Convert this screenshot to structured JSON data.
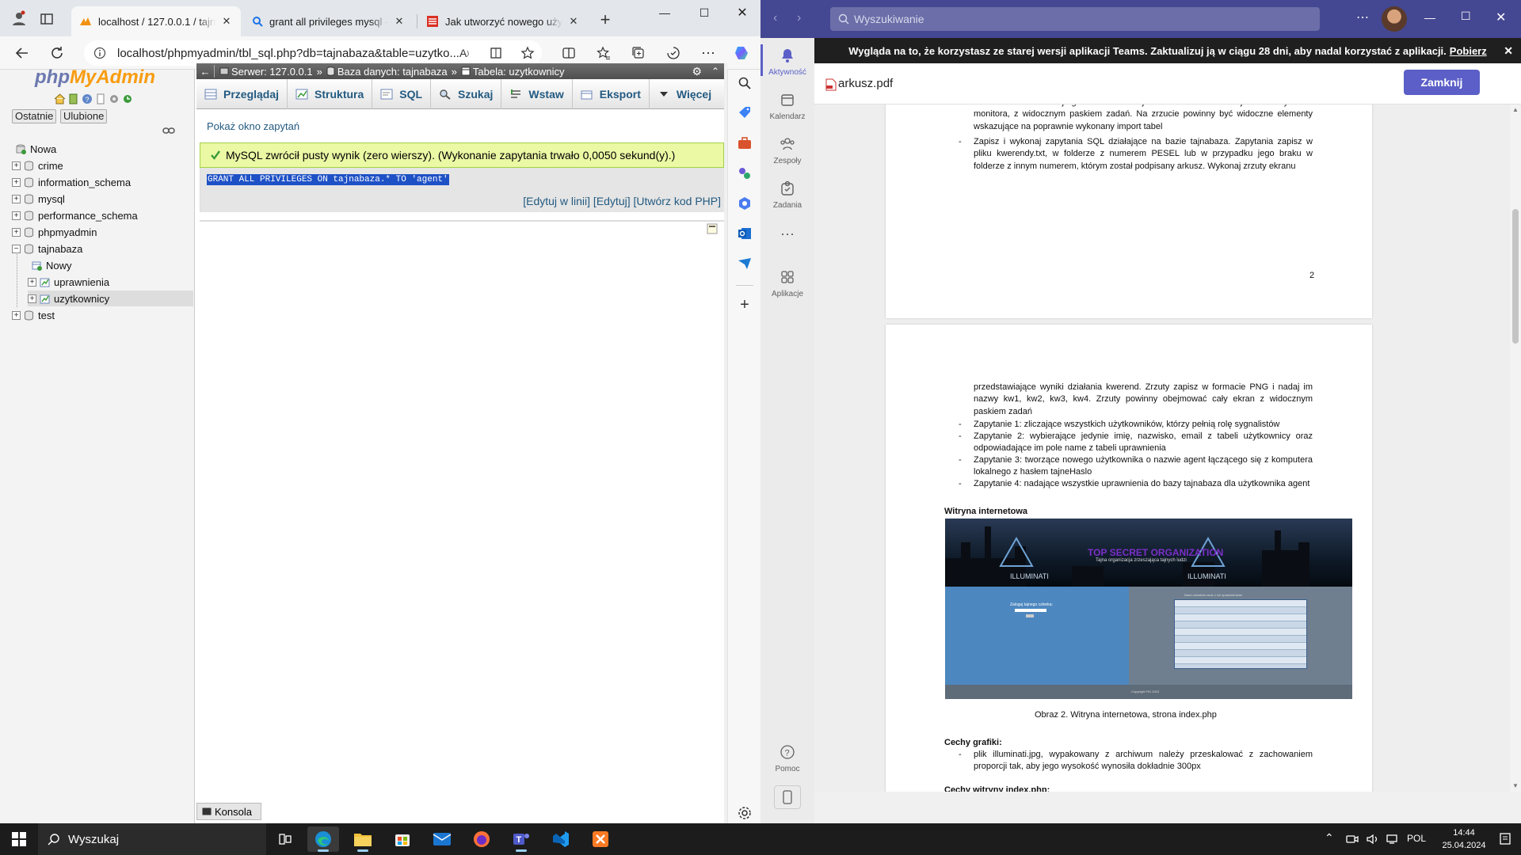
{
  "browser": {
    "tabs": [
      {
        "title": "localhost / 127.0.0.1 / tajnab..."
      },
      {
        "title": "grant all privileges mysql - W..."
      },
      {
        "title": "Jak utworzyć nowego użytko..."
      }
    ],
    "url": "localhost/phpmyadmin/tbl_sql.php?db=tajnabaza&table=uzytko..."
  },
  "pma": {
    "logo_php": "php",
    "logo_myadmin": "MyAdmin",
    "recent_label": "Ostatnie",
    "favorites_label": "Ulubione",
    "tree": [
      {
        "label": "Nowa"
      },
      {
        "label": "crime"
      },
      {
        "label": "information_schema"
      },
      {
        "label": "mysql"
      },
      {
        "label": "performance_schema"
      },
      {
        "label": "phpmyadmin"
      },
      {
        "label": "tajnabaza"
      },
      {
        "label": "Nowy"
      },
      {
        "label": "uprawnienia"
      },
      {
        "label": "uzytkownicy"
      },
      {
        "label": "test"
      }
    ],
    "breadcrumb": {
      "server": "Serwer: 127.0.0.1",
      "database": "Baza danych: tajnabaza",
      "table": "Tabela: uzytkownicy"
    },
    "tabs": [
      "Przeglądaj",
      "Struktura",
      "SQL",
      "Szukaj",
      "Wstaw",
      "Eksport",
      "Więcej"
    ],
    "show_query_link": "Pokaż okno zapytań",
    "success_message": "MySQL zwrócił pusty wynik (zero wierszy). (Wykonanie zapytania trwało 0,0050 sekund(y).)",
    "sql_query": "GRANT ALL PRIVILEGES ON tajnabaza.* TO 'agent'",
    "links": {
      "inline_edit": "Edytuj w linii",
      "edit": "Edytuj",
      "php_code": "Utwórz kod PHP"
    },
    "console_label": "Konsola"
  },
  "teams": {
    "search_placeholder": "Wyszukiwanie",
    "rail": [
      "Aktywność",
      "Kalendarz",
      "Zespoły",
      "Zadania",
      "Aplikacje",
      "Pomoc"
    ],
    "banner_text": "Wygląda na to, że korzystasz ze starej wersji aplikacji Teams. Zaktualizuj ją w ciągu 28 dni, aby nadal korzystać z aplikacji.",
    "banner_link": "Pobierz",
    "file_name": "arkusz.pdf",
    "close_button": "Zamknij",
    "pdf": {
      "p2_lines_top": "formacie JPEG i nazwij egzamin. Nie kadruj zrzutu. Powinien on obejmować cały ekran monitora, z widocznym paskiem zadań. Na zrzucie powinny być widoczne elementy wskazujące na poprawnie wykonany import tabel",
      "p2_item": "Zapisz i wykonaj zapytania SQL działające na bazie tajnabaza. Zapytania zapisz w pliku kwerendy.txt, w folderze z numerem PESEL lub w przypadku jego braku w folderze z innym numerem, którym został podpisany arkusz. Wykonaj zrzuty ekranu",
      "page_number": "2",
      "p3_intro": "przedstawiające wyniki działania kwerend. Zrzuty zapisz w formacie PNG i nadaj im nazwy kw1, kw2, kw3, kw4. Zrzuty powinny obejmować cały ekran z widocznym paskiem zadań",
      "q1": "Zapytanie 1: zliczające wszystkich użytkowników, którzy pełnią rolę sygnalistów",
      "q2": "Zapytanie 2: wybierające jedynie imię, nazwisko, email z tabeli użytkownicy oraz odpowiadające im pole name z tabeli uprawnienia",
      "q3": "Zapytanie 3: tworzące nowego użytkownika o nazwie agent łączącego się z komputera lokalnego z hasłem tajneHaslo",
      "q4": "Zapytanie 4: nadające wszystkie uprawnienia do bazy tajnabaza dla użytkownika agent",
      "site_heading": "Witryna internetowa",
      "site_banner_title": "TOP SECRET ORGANIZATION",
      "site_banner_sub": "Tajna organizacja zrzeszająca tajnych ludzi",
      "site_illuminati": "ILLUMINATI",
      "site_form_label": "Zaloguj tajnego członka:",
      "site_table_caption": "Dane członków wraz z ich uprawnieniami",
      "site_footer": "Copyright PIG 2023",
      "figure_caption": "Obraz 2. Witryna internetowa, strona index.php",
      "graphics_heading": "Cechy grafiki:",
      "graphics_item": "plik illuminati.jpg, wypakowany z archiwum należy przeskalować z zachowaniem proporcji tak, aby jego wysokość wynosiła dokładnie 300px",
      "index_heading": "Cechy witryny index.php:"
    }
  },
  "taskbar": {
    "search_placeholder": "Wyszukaj",
    "language": "POL",
    "time": "14:44",
    "date": "25.04.2024"
  }
}
